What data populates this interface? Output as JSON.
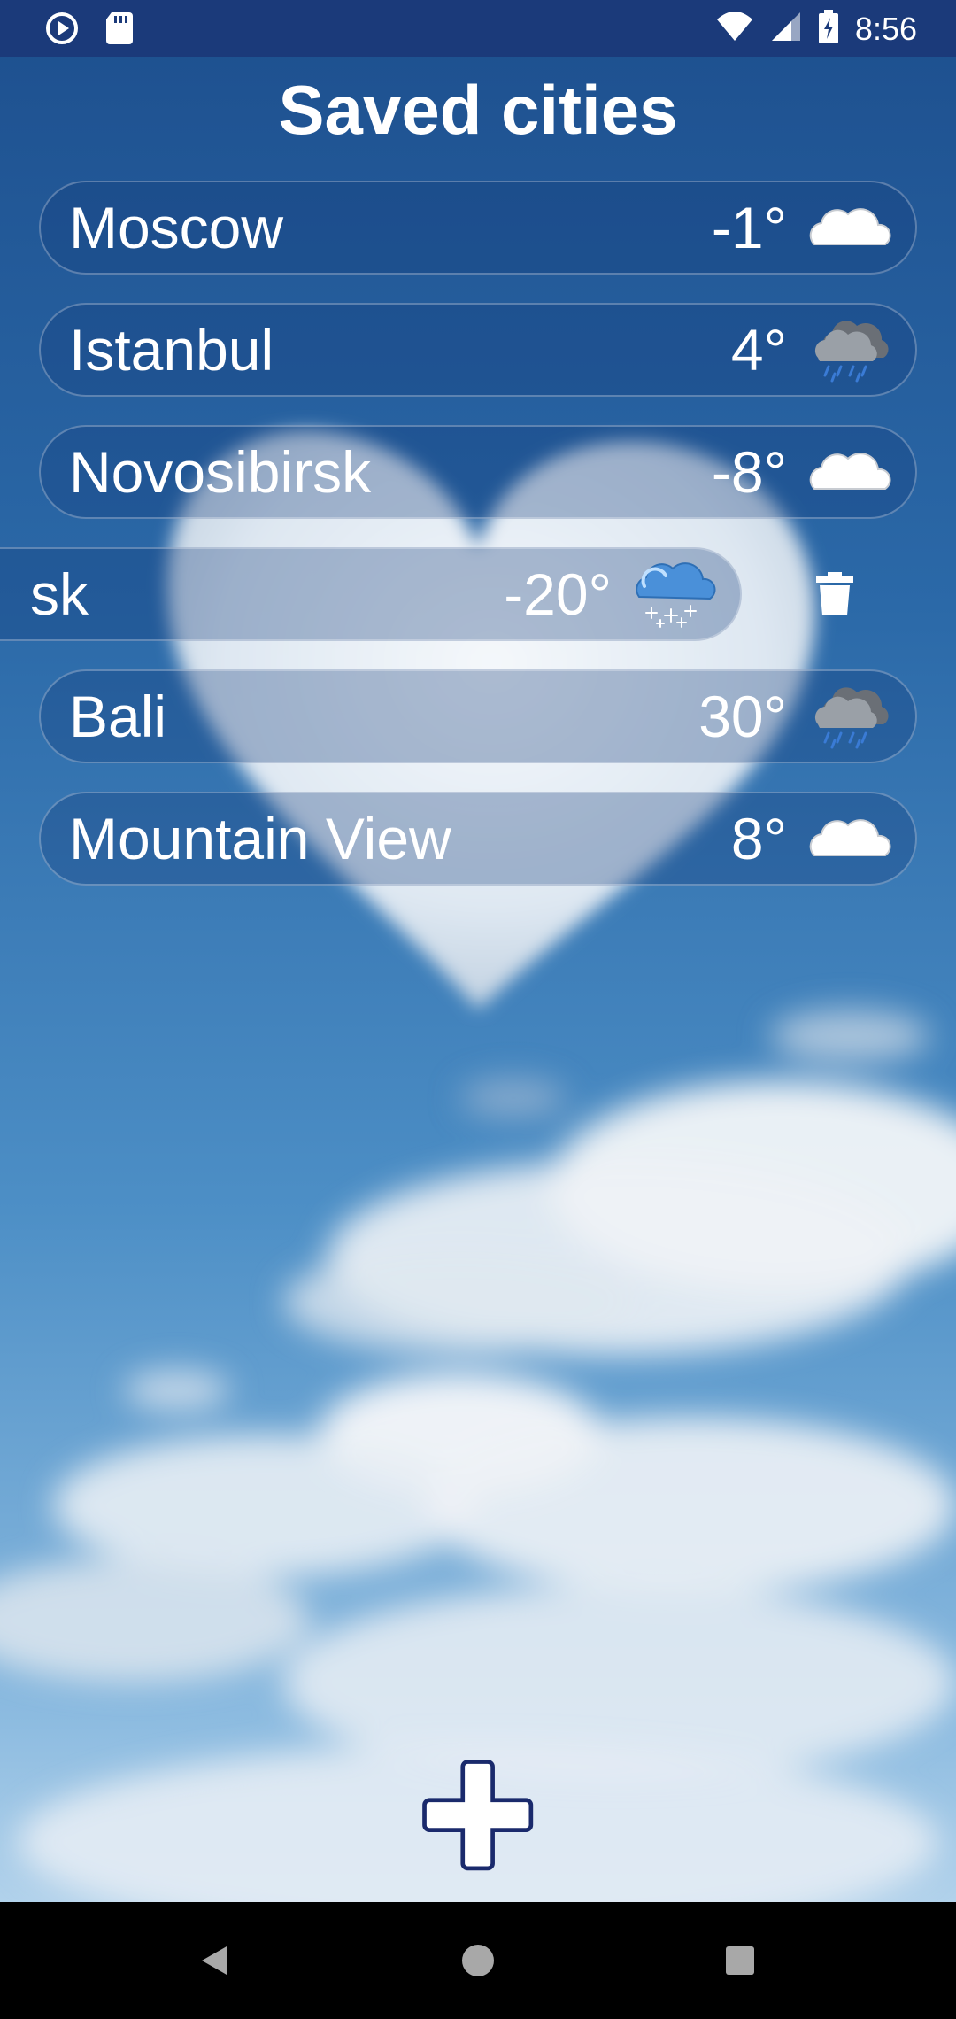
{
  "status_bar": {
    "time": "8:56",
    "left_icons": [
      "play-icon",
      "sd-card-icon"
    ],
    "right_icons": [
      "wifi-icon",
      "signal-icon",
      "battery-charging-icon"
    ]
  },
  "title": "Saved cities",
  "cities": [
    {
      "name": "Moscow",
      "temp": "-1°",
      "icon": "cloudy-icon"
    },
    {
      "name": "Istanbul",
      "temp": "4°",
      "icon": "rain-icon"
    },
    {
      "name": "Novosibirsk",
      "temp": "-8°",
      "icon": "cloudy-icon"
    },
    {
      "name": "sk",
      "temp": "-20°",
      "icon": "snow-icon",
      "swiped": true
    },
    {
      "name": "Bali",
      "temp": "30°",
      "icon": "rain-icon"
    },
    {
      "name": "Mountain View",
      "temp": "8°",
      "icon": "cloudy-icon"
    }
  ],
  "actions": {
    "delete_icon": "trash-icon",
    "add_icon": "plus-icon"
  },
  "nav_bar": {
    "icons": [
      "back-icon",
      "home-icon",
      "recents-icon"
    ]
  },
  "colors": {
    "status_bar": "#1b3a7a",
    "sky_top": "#1d4f8e",
    "sky_bottom": "#c9e0f2",
    "text": "#ffffff"
  }
}
